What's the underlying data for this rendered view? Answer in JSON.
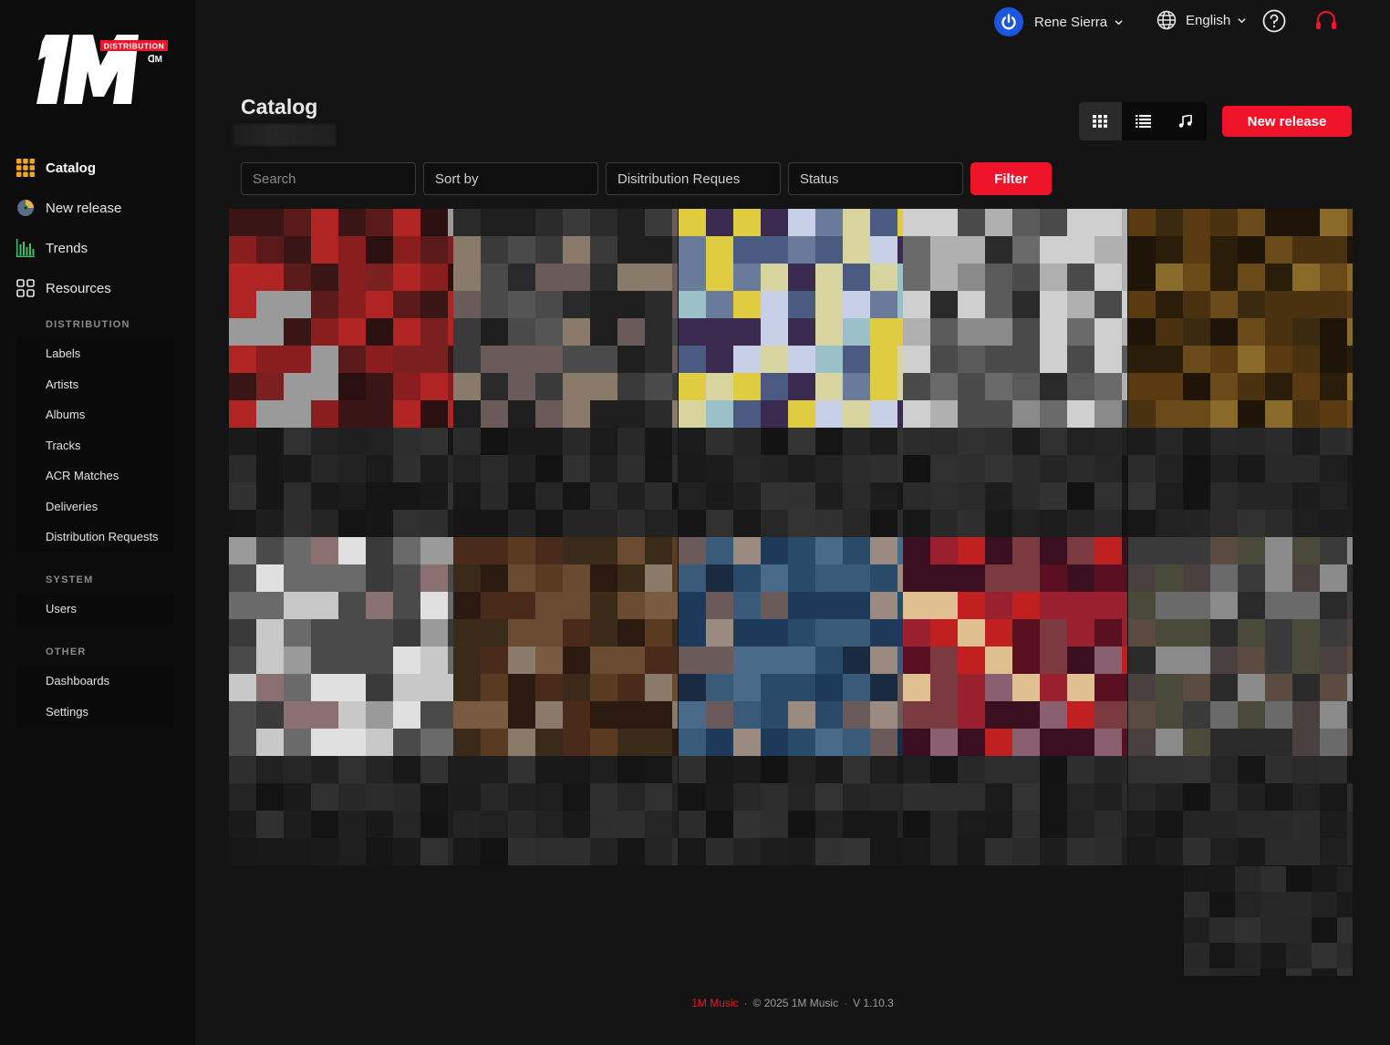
{
  "brand": {
    "logo_text": "1M",
    "logo_badge": "DISTRIBUTION",
    "accent": "#f0142a"
  },
  "sidebar": {
    "main": [
      {
        "label": "Catalog",
        "icon": "grid-icon",
        "active": true
      },
      {
        "label": "New release",
        "icon": "disc-icon",
        "active": false
      },
      {
        "label": "Trends",
        "icon": "bar-chart-icon",
        "active": false
      },
      {
        "label": "Resources",
        "icon": "apps-icon",
        "active": false
      }
    ],
    "sections": [
      {
        "title": "DISTRIBUTION",
        "items": [
          "Labels",
          "Artists",
          "Albums",
          "Tracks",
          "ACR Matches",
          "Deliveries",
          "Distribution Requests"
        ]
      },
      {
        "title": "SYSTEM",
        "items": [
          "Users"
        ]
      },
      {
        "title": "OTHER",
        "items": [
          "Dashboards",
          "Settings"
        ]
      }
    ]
  },
  "topbar": {
    "user_name": "Rene Sierra",
    "language": "English",
    "help_icon": "help-icon",
    "support_icon": "headset-icon"
  },
  "header": {
    "title": "Catalog",
    "views": [
      "grid-view-icon",
      "list-view-icon",
      "music-note-icon"
    ],
    "active_view": 0,
    "new_release_label": "New release"
  },
  "filters": {
    "search_placeholder": "Search",
    "sort_label": "Sort by",
    "distribution_label": "Disitribution Reques",
    "status_label": "Status",
    "filter_label": "Filter"
  },
  "footer": {
    "brand": "1M Music",
    "copyright": "© 2025 1M Music",
    "version": "V 1.10.3"
  }
}
